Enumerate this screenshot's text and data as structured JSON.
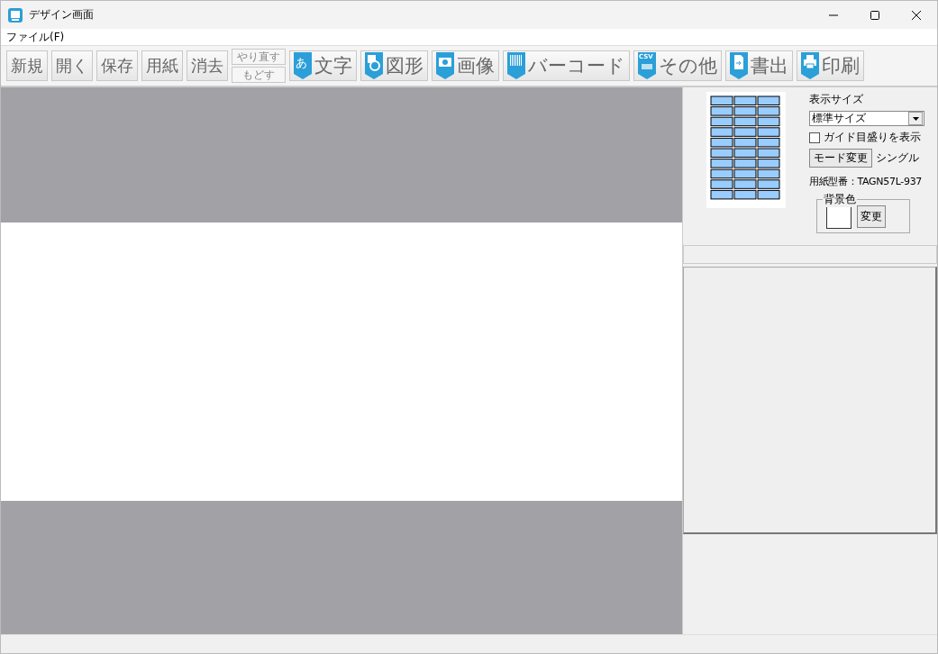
{
  "window": {
    "title": "デザイン画面"
  },
  "menu": [
    {
      "label": "ファイル(F)"
    }
  ],
  "toolbar": [
    {
      "kind": "plain",
      "label": "新規"
    },
    {
      "kind": "plain",
      "label": "開く"
    },
    {
      "kind": "plain",
      "label": "保存"
    },
    {
      "kind": "plain",
      "label": "用紙"
    },
    {
      "kind": "plain",
      "label": "消去"
    },
    {
      "kind": "stack",
      "labels": [
        "やり直す",
        "もどす"
      ]
    },
    {
      "kind": "text",
      "label": "文字",
      "badge": "あ"
    },
    {
      "kind": "shape",
      "label": "図形"
    },
    {
      "kind": "image",
      "label": "画像"
    },
    {
      "kind": "barcode",
      "label": "バーコード"
    },
    {
      "kind": "csv",
      "label": "その他",
      "badge": "CSV"
    },
    {
      "kind": "export",
      "label": "書出"
    },
    {
      "kind": "print",
      "label": "印刷"
    }
  ],
  "panel": {
    "display_size_label": "表示サイズ",
    "display_size_value": "標準サイズ",
    "guide": {
      "label": "ガイド目盛りを表示",
      "checked": false
    },
    "mode_button": "モード変更",
    "mode_value": "シングル",
    "paper_model": "用紙型番：TAGN57L-937",
    "background": {
      "legend": "背景色",
      "color": "#ffffff",
      "button": "変更"
    }
  }
}
